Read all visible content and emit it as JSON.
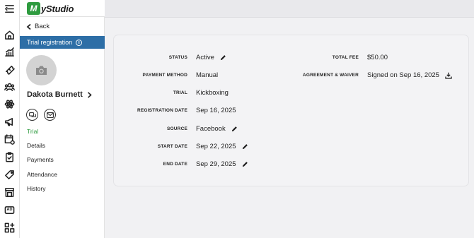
{
  "app": {
    "logo_mark": "M",
    "logo_text": "yStudio"
  },
  "rail": {
    "icons": [
      "menu-icon",
      "home-icon",
      "chart-icon",
      "ticket-icon",
      "people-icon",
      "atom-icon",
      "megaphone-icon",
      "calendar-settings-icon",
      "clipboard-check-icon",
      "tag-icon",
      "store-icon",
      "ad-icon",
      "apps-icon"
    ],
    "ad_label": "AD"
  },
  "sidebar": {
    "back_label": "Back",
    "section_title": "Trial registration",
    "info_glyph": "i",
    "member_name": "Dakota Burnett",
    "nav": [
      {
        "label": "Trial",
        "active": true
      },
      {
        "label": "Details",
        "active": false
      },
      {
        "label": "Payments",
        "active": false
      },
      {
        "label": "Attendance",
        "active": false
      },
      {
        "label": "History",
        "active": false
      }
    ]
  },
  "details": {
    "status": {
      "label": "STATUS",
      "value": "Active"
    },
    "payment_method": {
      "label": "PAYMENT METHOD",
      "value": "Manual"
    },
    "trial": {
      "label": "TRIAL",
      "value": "Kickboxing"
    },
    "registration_date": {
      "label": "REGISTRATION DATE",
      "value": "Sep 16, 2025"
    },
    "source": {
      "label": "SOURCE",
      "value": "Facebook"
    },
    "start_date": {
      "label": "START DATE",
      "value": "Sep 22, 2025"
    },
    "end_date": {
      "label": "END DATE",
      "value": "Sep 29, 2025"
    },
    "total_fee": {
      "label": "TOTAL FEE",
      "value": "$50.00"
    },
    "agreement": {
      "label": "AGREEMENT & WAIVER",
      "value": "Signed on Sep 16, 2025"
    }
  },
  "colors": {
    "accent_blue": "#2d6ea6",
    "active_green": "#2e9b3f",
    "logo_green": "#2e9b3f"
  }
}
